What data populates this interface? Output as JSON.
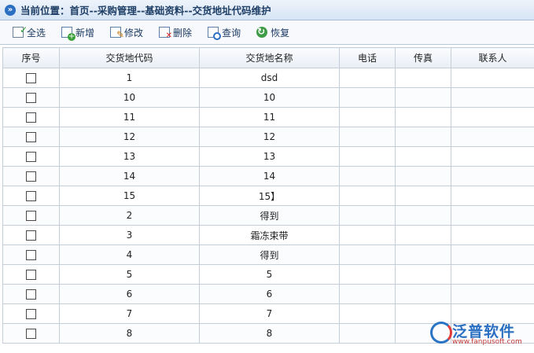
{
  "breadcrumb": {
    "icon": "double-chevron-right-icon",
    "text": "当前位置：首页--采购管理--基础资料--交货地址代码维护"
  },
  "toolbar": {
    "buttons": [
      {
        "label": "全选",
        "icon": "select-all-icon"
      },
      {
        "label": "新增",
        "icon": "add-icon"
      },
      {
        "label": "修改",
        "icon": "edit-icon"
      },
      {
        "label": "删除",
        "icon": "delete-icon"
      },
      {
        "label": "查询",
        "icon": "search-icon"
      },
      {
        "label": "恢复",
        "icon": "restore-icon"
      }
    ]
  },
  "table": {
    "headers": [
      "序号",
      "交货地代码",
      "交货地名称",
      "电话",
      "传真",
      "联系人"
    ],
    "rows": [
      {
        "code": "1",
        "name": "dsd",
        "phone": "",
        "fax": "",
        "contact": ""
      },
      {
        "code": "10",
        "name": "10",
        "phone": "",
        "fax": "",
        "contact": ""
      },
      {
        "code": "11",
        "name": "11",
        "phone": "",
        "fax": "",
        "contact": ""
      },
      {
        "code": "12",
        "name": "12",
        "phone": "",
        "fax": "",
        "contact": ""
      },
      {
        "code": "13",
        "name": "13",
        "phone": "",
        "fax": "",
        "contact": ""
      },
      {
        "code": "14",
        "name": "14",
        "phone": "",
        "fax": "",
        "contact": ""
      },
      {
        "code": "15",
        "name": "15】",
        "phone": "",
        "fax": "",
        "contact": ""
      },
      {
        "code": "2",
        "name": "得到",
        "phone": "",
        "fax": "",
        "contact": ""
      },
      {
        "code": "3",
        "name": "霜冻束带",
        "phone": "",
        "fax": "",
        "contact": ""
      },
      {
        "code": "4",
        "name": "得到",
        "phone": "",
        "fax": "",
        "contact": ""
      },
      {
        "code": "5",
        "name": "5",
        "phone": "",
        "fax": "",
        "contact": ""
      },
      {
        "code": "6",
        "name": "6",
        "phone": "",
        "fax": "",
        "contact": ""
      },
      {
        "code": "7",
        "name": "7",
        "phone": "",
        "fax": "",
        "contact": ""
      },
      {
        "code": "8",
        "name": "8",
        "phone": "",
        "fax": "",
        "contact": ""
      }
    ]
  },
  "watermark": {
    "name": "泛普软件",
    "url": "www.fanpusoft.com"
  },
  "colors": {
    "accent": "#2a6fc1",
    "header_bg": "#e9eef5",
    "border": "#c5ced8"
  }
}
